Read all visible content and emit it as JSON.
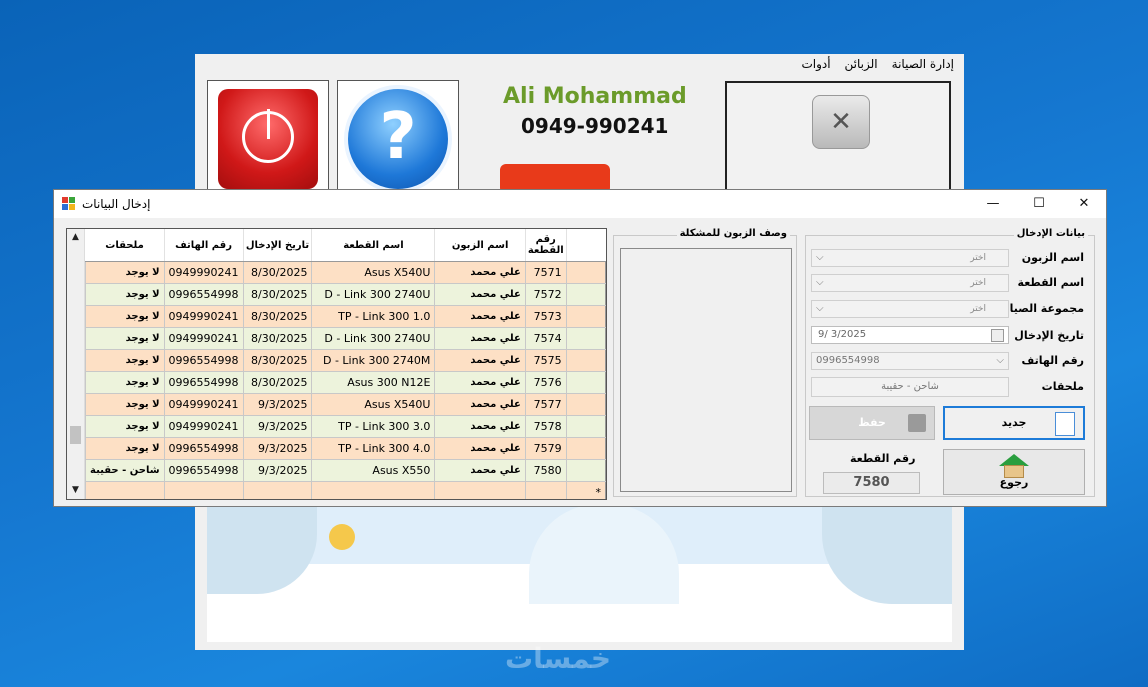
{
  "main_window": {
    "menu": [
      "إدارة الصيانة",
      "الزبائن",
      "أدوات"
    ],
    "owner_name": "Ali Mohammad",
    "owner_phone": "0949-990241",
    "help_symbol": "?",
    "watermark": "خمسات"
  },
  "dialog": {
    "title": "إدخال البيانات",
    "controls": {
      "minimize": "—",
      "maximize": "☐",
      "close": "✕"
    },
    "grid": {
      "columns": [
        "رقم القطعة",
        "اسم الزبون",
        "اسم القطعة",
        "تاريخ الإدخال",
        "رقم الهاتف",
        "ملحقات"
      ],
      "rows": [
        [
          "7571",
          "علي محمد",
          "Asus X540U",
          "8/30/2025",
          "0949990241",
          "لا يوجد"
        ],
        [
          "7572",
          "علي محمد",
          "D - Link 300 2740U",
          "8/30/2025",
          "0996554998",
          "لا يوجد"
        ],
        [
          "7573",
          "علي محمد",
          "TP - Link 300 1.0",
          "8/30/2025",
          "0949990241",
          "لا يوجد"
        ],
        [
          "7574",
          "علي محمد",
          "D - Link 300 2740U",
          "8/30/2025",
          "0949990241",
          "لا يوجد"
        ],
        [
          "7575",
          "علي محمد",
          "D - Link 300 2740M",
          "8/30/2025",
          "0996554998",
          "لا يوجد"
        ],
        [
          "7576",
          "علي محمد",
          "Asus 300 N12E",
          "8/30/2025",
          "0996554998",
          "لا يوجد"
        ],
        [
          "7577",
          "علي محمد",
          "Asus X540U",
          "9/3/2025",
          "0949990241",
          "لا يوجد"
        ],
        [
          "7578",
          "علي محمد",
          "TP - Link 300 3.0",
          "9/3/2025",
          "0949990241",
          "لا يوجد"
        ],
        [
          "7579",
          "علي محمد",
          "TP - Link 300 4.0",
          "9/3/2025",
          "0996554998",
          "لا يوجد"
        ],
        [
          "7580",
          "علي محمد",
          "Asus X550",
          "9/3/2025",
          "0996554998",
          "شاحن - حقيبة"
        ]
      ],
      "new_row_marker": "*"
    },
    "description_group": {
      "legend": "وصف الزبون للمشكلة"
    },
    "input_group": {
      "legend": "بيانات الإدخال",
      "labels": {
        "customer": "اسم الزبون",
        "part_name": "اسم القطعة",
        "maintenance_group": "مجموعة الصيانة",
        "entry_date": "تاريخ الإدخال",
        "phone": "رقم الهاتف",
        "accessories": "ملحقات"
      },
      "customer_value": "اختر",
      "part_value": "اختر",
      "group_value": "اختر",
      "date_value": "9/  3/2025",
      "phone_value": "0996554998",
      "accessories_value": "شاحن - حقيبة",
      "new_button": "جديد",
      "save_button": "حفظ",
      "back_button": "رجوع",
      "part_number_label": "رقم القطعة",
      "part_number_value": "7580"
    }
  }
}
